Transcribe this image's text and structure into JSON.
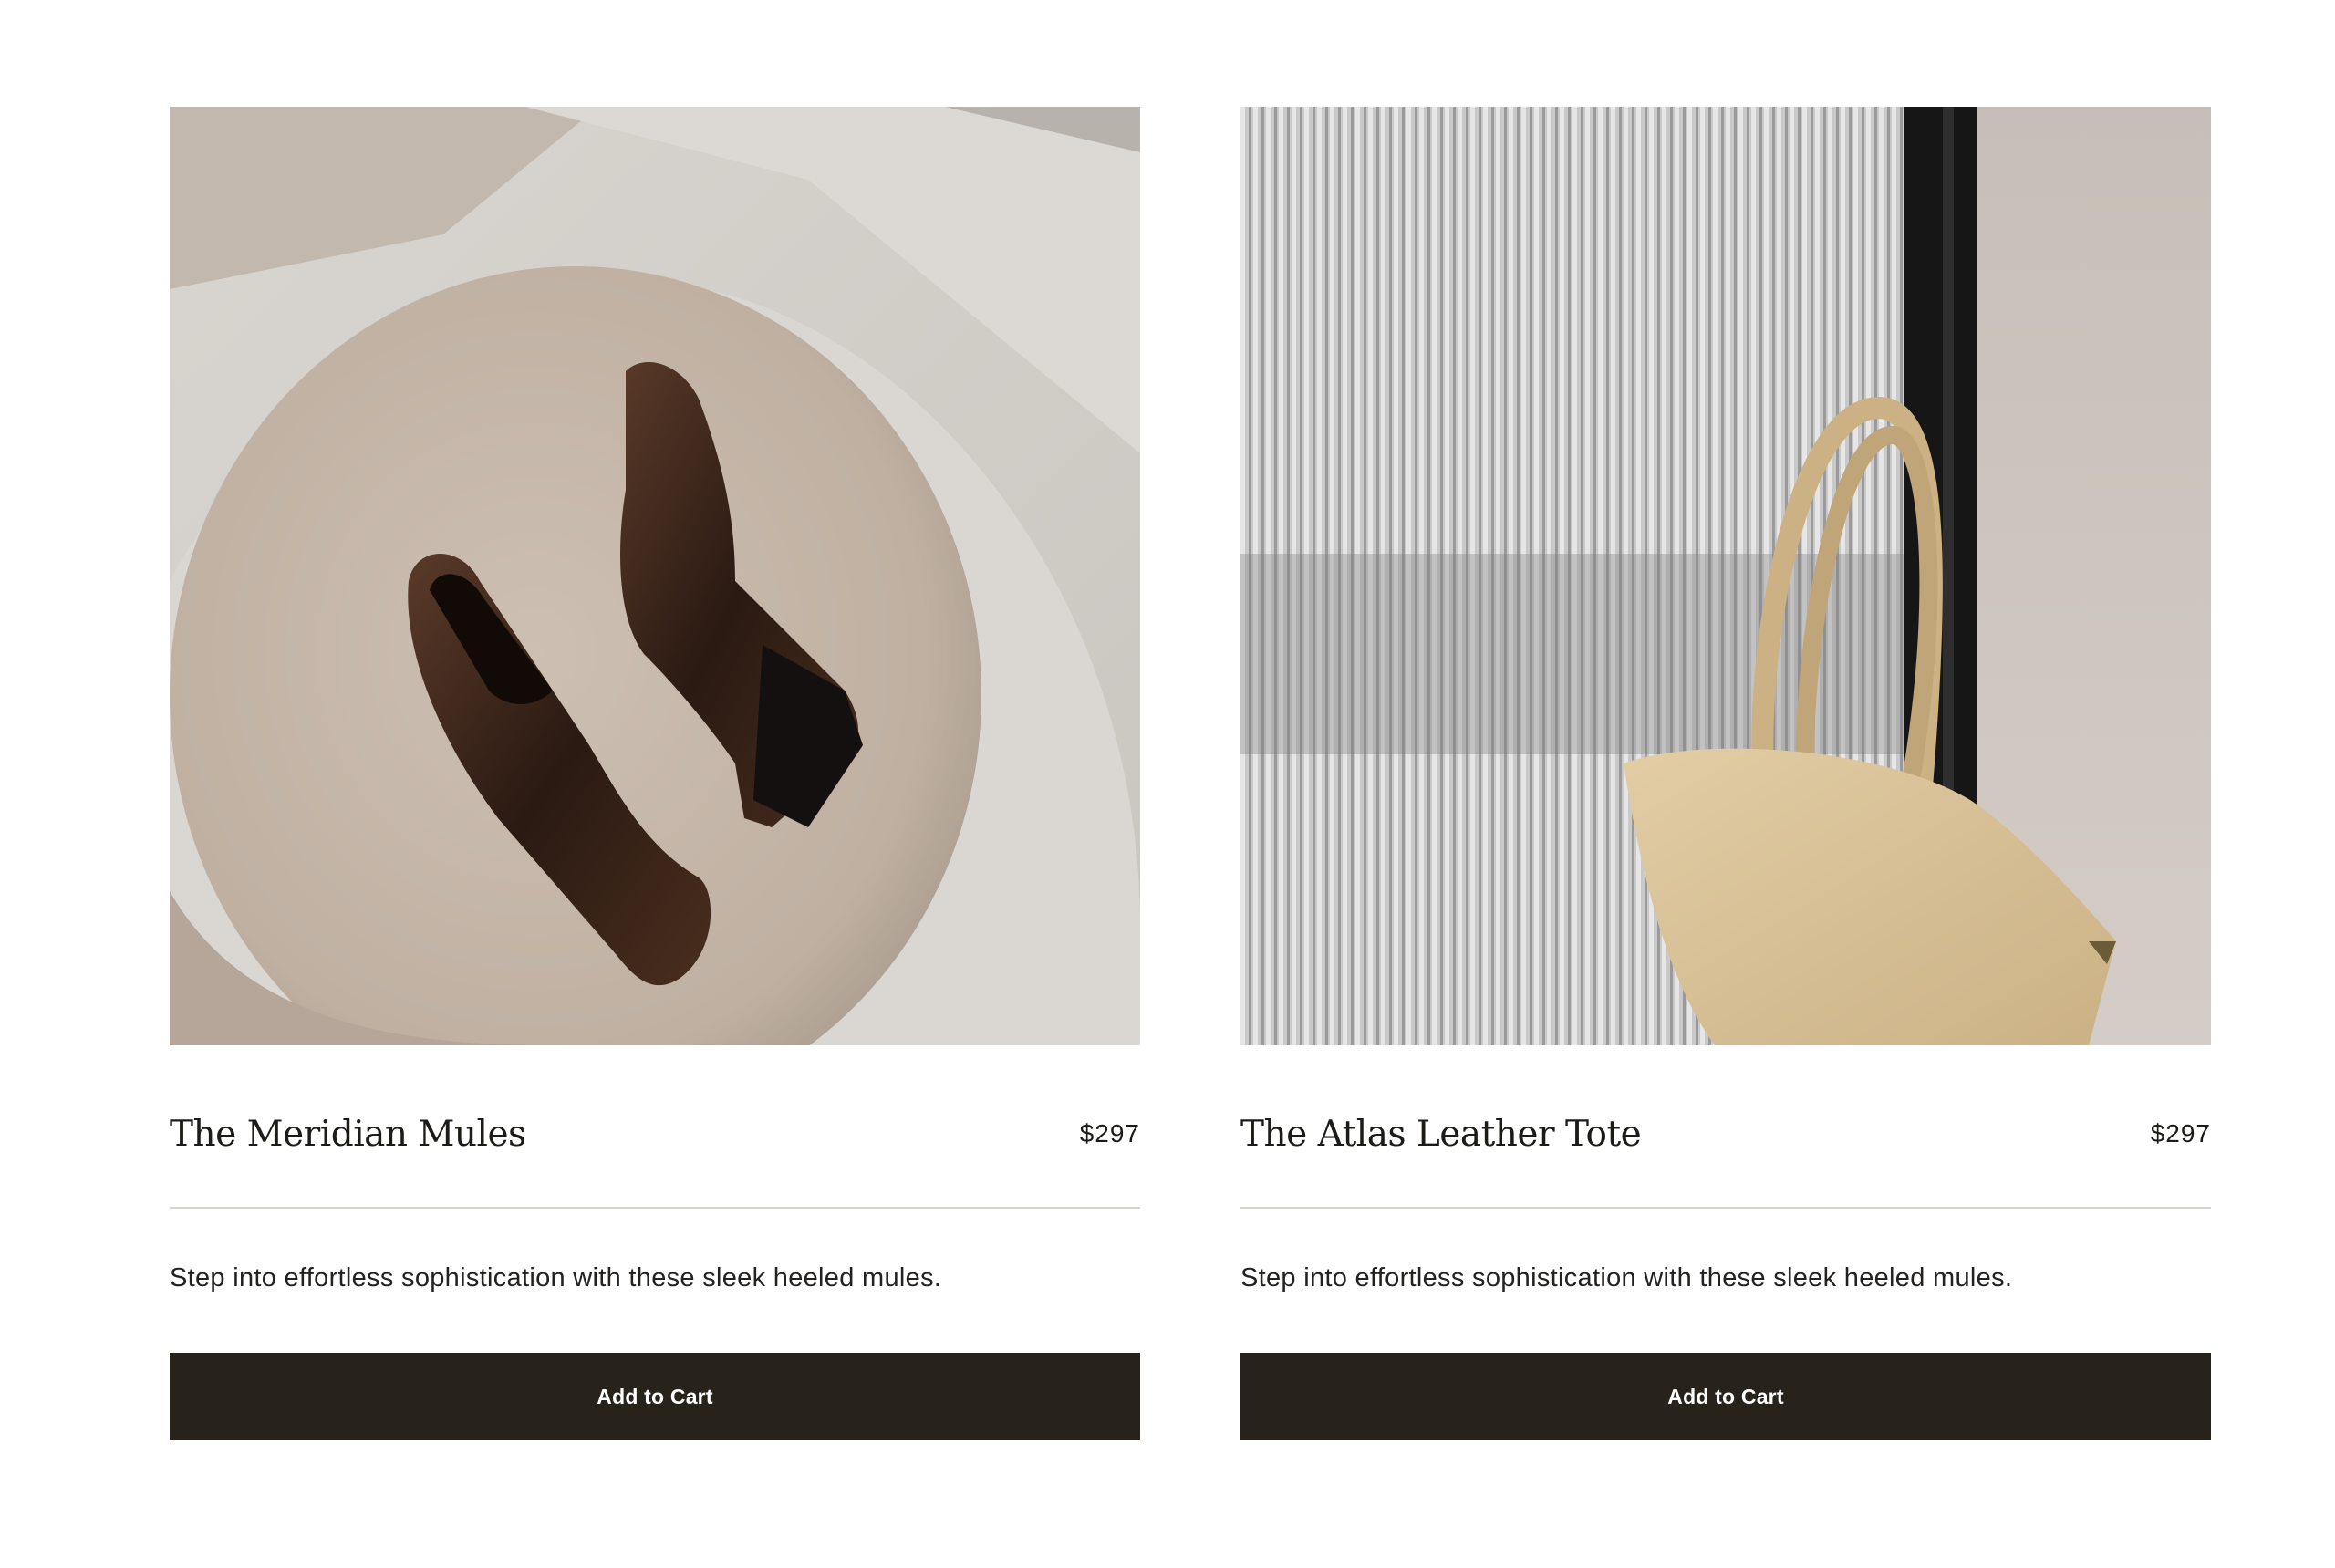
{
  "products": [
    {
      "title": "The Meridian Mules",
      "price": "$297",
      "description": "Step into effortless sophistication with these sleek heeled mules.",
      "cta_label": "Add to Cart",
      "image_subject": "brown-heeled-mules-on-velvet-stool"
    },
    {
      "title": "The Atlas Leather Tote",
      "price": "$297",
      "description": "Step into effortless sophistication with these sleek heeled mules.",
      "cta_label": "Add to Cart",
      "image_subject": "beige-ostrich-leather-tote-hanging"
    }
  ],
  "colors": {
    "button_bg": "#27231a",
    "button_text": "#ffffff",
    "text": "#1d1b17",
    "divider": "#d6d3cf"
  }
}
